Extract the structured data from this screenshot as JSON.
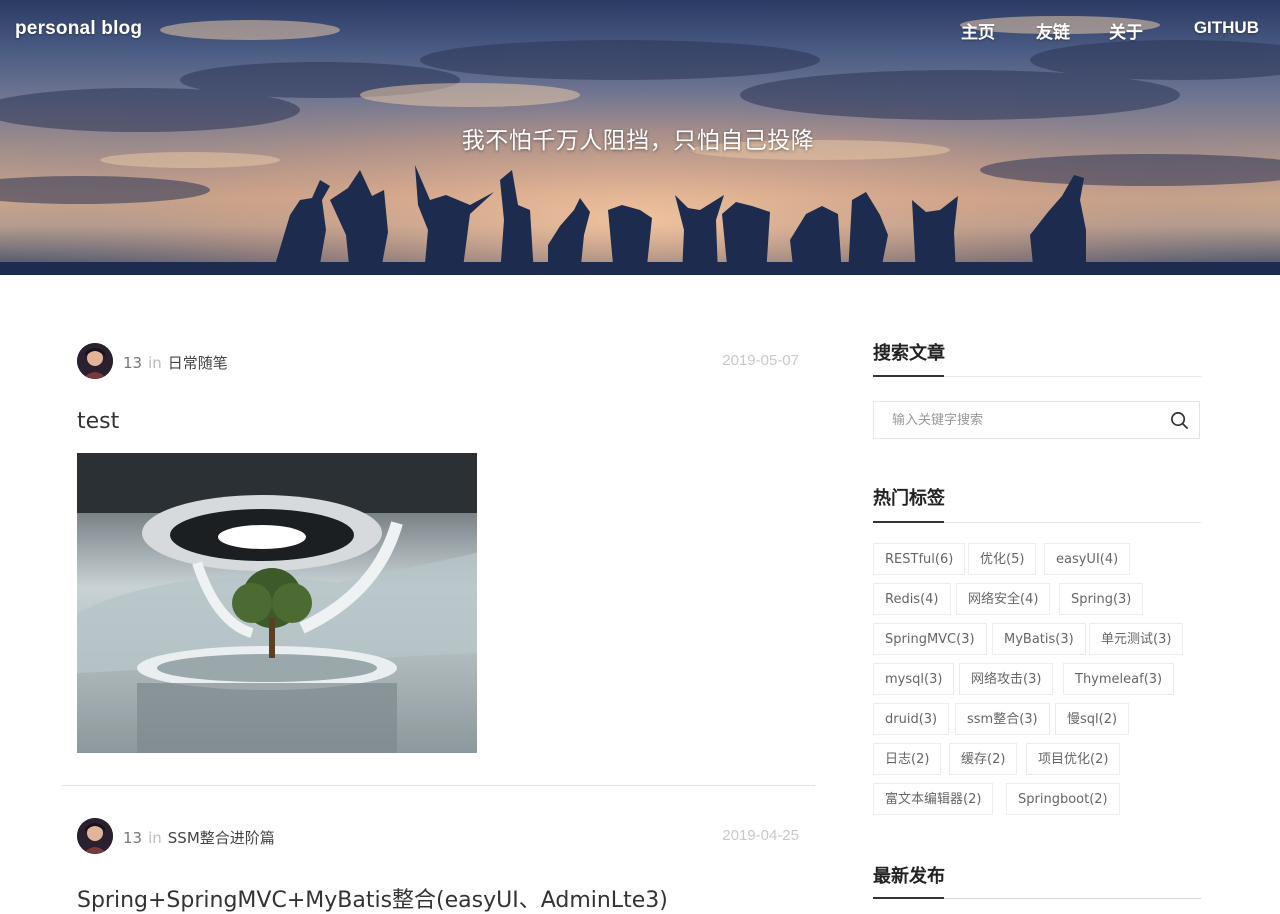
{
  "header": {
    "brand": "personal blog",
    "nav": [
      "主页",
      "友链",
      "关于",
      "GITHUB"
    ],
    "motto": "我不怕千万人阻挡，只怕自己投降"
  },
  "posts": [
    {
      "author": "13",
      "in_label": "in",
      "category": "日常随笔",
      "date": "2019-05-07",
      "title": "test",
      "has_image": true
    },
    {
      "author": "13",
      "in_label": "in",
      "category": "SSM整合进阶篇",
      "date": "2019-04-25",
      "title": "Spring+SpringMVC+MyBatis整合(easyUI、AdminLte3)"
    }
  ],
  "sidebar": {
    "search_title": "搜索文章",
    "search_placeholder": "输入关键字搜索",
    "tags_title": "热门标签",
    "tags": [
      "RESTful(6)",
      "优化(5)",
      "easyUI(4)",
      "Redis(4)",
      "网络安全(4)",
      "Spring(3)",
      "SpringMVC(3)",
      "MyBatis(3)",
      "单元测试(3)",
      "mysql(3)",
      "网络攻击(3)",
      "Thymeleaf(3)",
      "druid(3)",
      "ssm整合(3)",
      "慢sql(2)",
      "日志(2)",
      "缓存(2)",
      "项目优化(2)",
      "富文本编辑器(2)",
      "Springboot(2)"
    ],
    "latest_title": "最新发布"
  },
  "colors": {
    "hero_sky": "#4a5b83",
    "silhouette": "#1c2b4e",
    "text": "#333333",
    "muted": "#c8c8c8"
  }
}
